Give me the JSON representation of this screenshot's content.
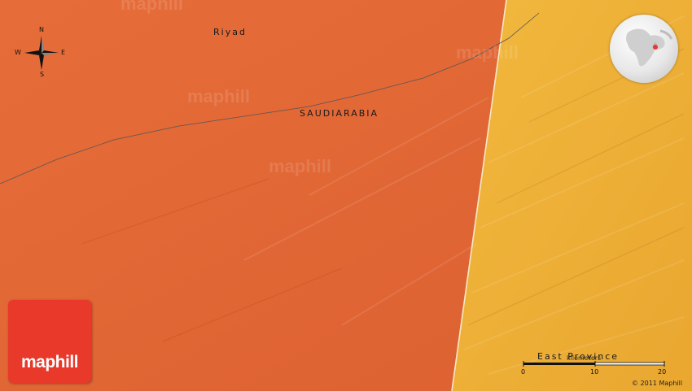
{
  "map": {
    "country_label": "SAUDIARABIA",
    "city_label": "Riyad",
    "province_label": "East Province",
    "compass": {
      "north": "N",
      "south": "S",
      "east": "E",
      "west": "W"
    },
    "scale": {
      "ticks": [
        "0",
        "10",
        "20"
      ],
      "unit": "kilometers"
    },
    "copyright": "© 2011 Maphill",
    "logo_text": "maphill",
    "watermark_text": "maphill",
    "colors": {
      "region_west": "#e46a37",
      "region_east": "#f0b83a",
      "border": "#f5e9c8",
      "road": "#555555",
      "logo_bg": "#e8392b"
    }
  }
}
